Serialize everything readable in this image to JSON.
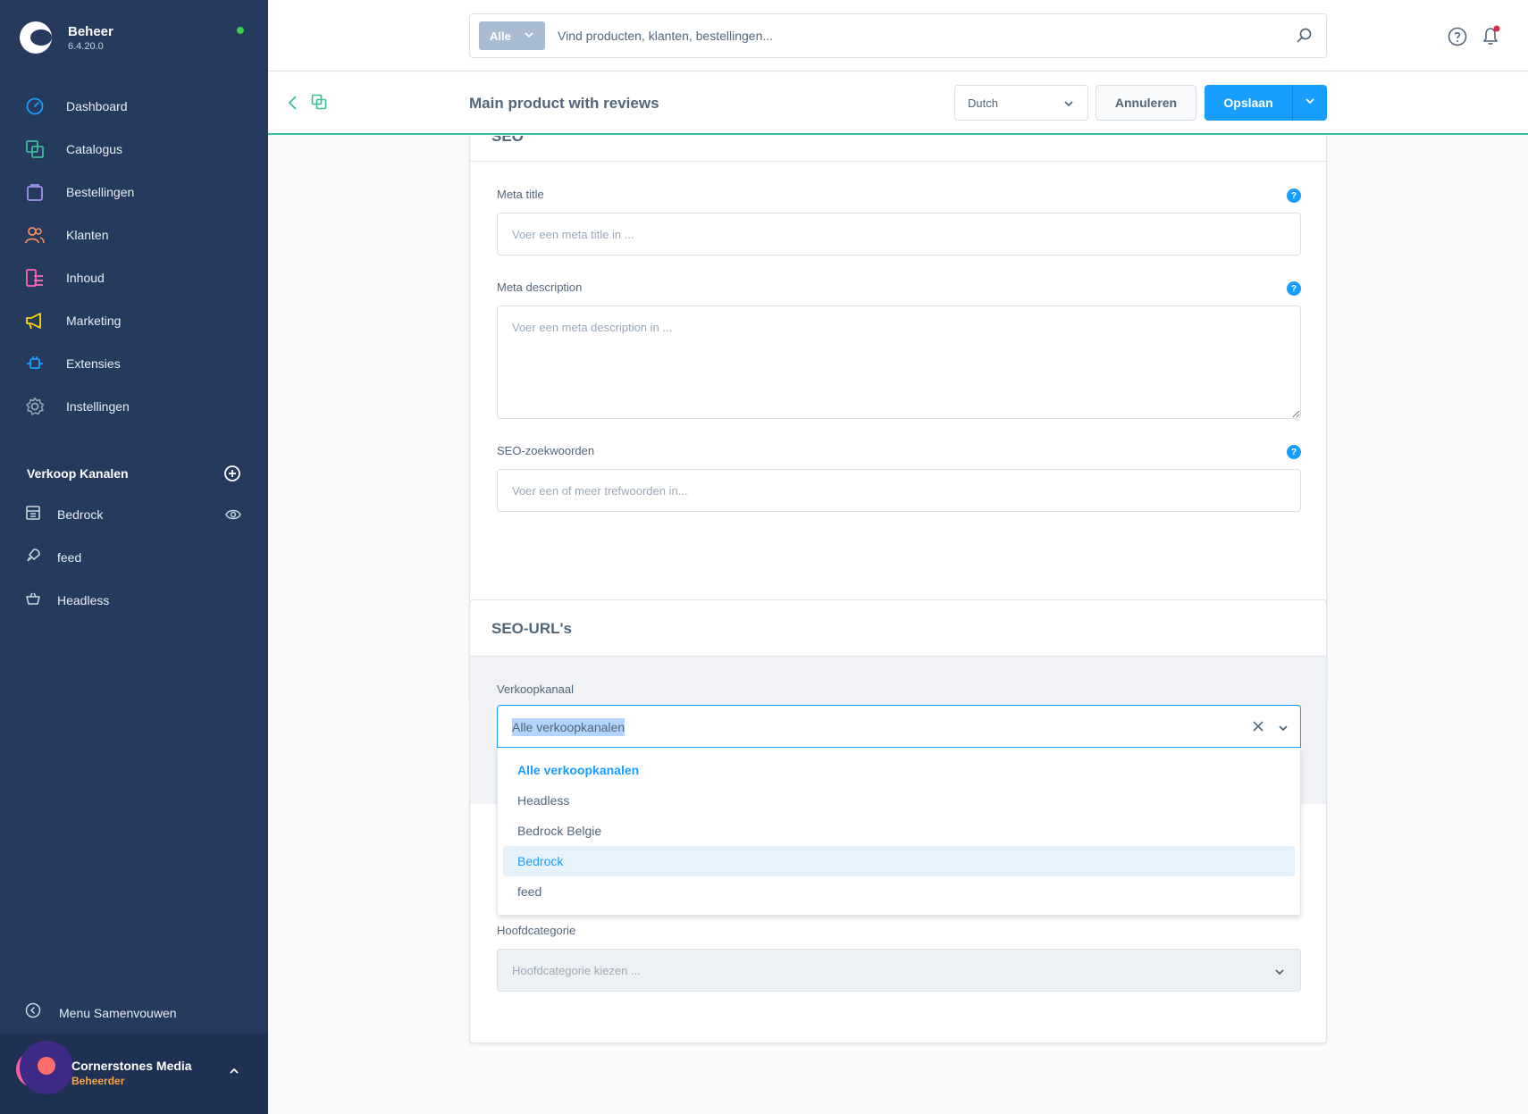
{
  "brand": {
    "name": "Beheer",
    "version": "6.4.20.0",
    "status_color": "#37d046"
  },
  "nav": {
    "items": [
      {
        "label": "Dashboard",
        "icon": "dashboard-icon",
        "color": "#189eff"
      },
      {
        "label": "Catalogus",
        "icon": "catalog-icon",
        "color": "#3bbd9b"
      },
      {
        "label": "Bestellingen",
        "icon": "orders-icon",
        "color": "#a092f0"
      },
      {
        "label": "Klanten",
        "icon": "customers-icon",
        "color": "#f88962"
      },
      {
        "label": "Inhoud",
        "icon": "content-icon",
        "color": "#ff68b4"
      },
      {
        "label": "Marketing",
        "icon": "marketing-icon",
        "color": "#ffd700"
      },
      {
        "label": "Extensies",
        "icon": "extensions-icon",
        "color": "#189eff"
      },
      {
        "label": "Instellingen",
        "icon": "settings-icon",
        "color": "#9aa8b5"
      }
    ]
  },
  "channels": {
    "title": "Verkoop Kanalen",
    "items": [
      {
        "label": "Bedrock",
        "icon": "storefront-icon"
      },
      {
        "label": "feed",
        "icon": "rocket-icon"
      },
      {
        "label": "Headless",
        "icon": "basket-icon"
      }
    ]
  },
  "sidebar_footer": {
    "collapse_label": "Menu Samenvouwen",
    "user_name": "Cornerstones Media",
    "user_role": "Beheerder"
  },
  "search": {
    "type_label": "Alle",
    "placeholder": "Vind producten, klanten, bestellingen..."
  },
  "smartbar": {
    "title": "Main product with reviews",
    "language": "Dutch",
    "cancel_label": "Annuleren",
    "save_label": "Opslaan"
  },
  "seo_card": {
    "title": "SEO",
    "meta_title_label": "Meta title",
    "meta_title_placeholder": "Voer een meta title in ...",
    "meta_description_label": "Meta description",
    "meta_description_placeholder": "Voer een meta description in ...",
    "keywords_label": "SEO-zoekwoorden",
    "keywords_placeholder": "Voer een of meer trefwoorden in...",
    "help_glyph": "?"
  },
  "seo_url_card": {
    "title": "SEO-URL's",
    "channel_label": "Verkoopkanaal",
    "channel_value": "Alle verkoopkanalen",
    "options": [
      "Alle verkoopkanalen",
      "Headless",
      "Bedrock Belgie",
      "Bedrock",
      "feed"
    ],
    "selected_option": "Alle verkoopkanalen",
    "hovered_option": "Bedrock",
    "main_category_label": "Hoofdcategorie",
    "main_category_placeholder": "Hoofdcategorie kiezen ..."
  },
  "colors": {
    "accent": "#189eff",
    "sidebar": "#253a5c",
    "smartbar_border": "#3bbd9b"
  }
}
